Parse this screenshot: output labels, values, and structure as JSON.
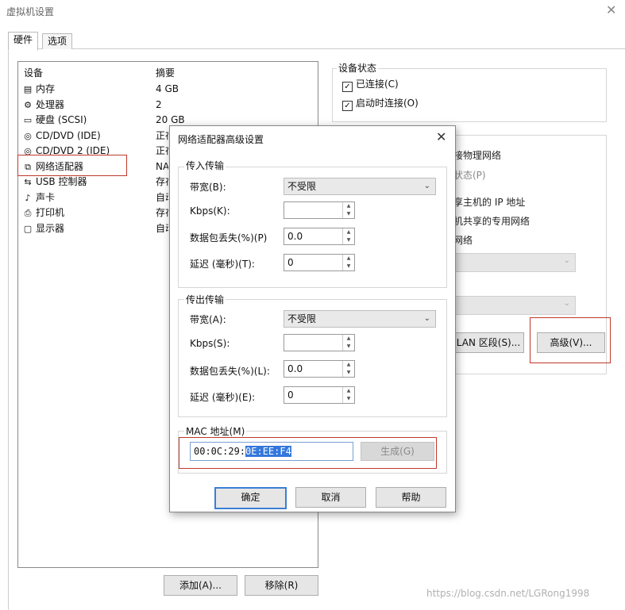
{
  "window": {
    "title": "虚拟机设置",
    "close_glyph": "✕"
  },
  "tabs": [
    {
      "label": "硬件"
    },
    {
      "label": "选项"
    }
  ],
  "device_list": {
    "col_device": "设备",
    "col_summary": "摘要",
    "items": [
      {
        "name": "内存",
        "summary": "4 GB",
        "icon": "memory-icon"
      },
      {
        "name": "处理器",
        "summary": "2",
        "icon": "cpu-icon"
      },
      {
        "name": "硬盘 (SCSI)",
        "summary": "20 GB",
        "icon": "disk-icon"
      },
      {
        "name": "CD/DVD (IDE)",
        "summary": "正在",
        "icon": "cd-icon"
      },
      {
        "name": "CD/DVD 2 (IDE)",
        "summary": "正在",
        "icon": "cd-icon"
      },
      {
        "name": "网络适配器",
        "summary": "NAT",
        "icon": "network-icon"
      },
      {
        "name": "USB 控制器",
        "summary": "存在",
        "icon": "usb-icon"
      },
      {
        "name": "声卡",
        "summary": "自动",
        "icon": "speaker-icon"
      },
      {
        "name": "打印机",
        "summary": "存在",
        "icon": "printer-icon"
      },
      {
        "name": "显示器",
        "summary": "自动",
        "icon": "monitor-icon"
      }
    ],
    "add_button": "添加(A)...",
    "remove_button": "移除(R)"
  },
  "device_status": {
    "label": "设备状态",
    "connected": {
      "label": "已连接(C)",
      "checked": true
    },
    "connect_on_start": {
      "label": "启动时连接(O)",
      "checked": true
    }
  },
  "background_partial": {
    "bridged": "接物理网络",
    "replicate": "状态(P)",
    "nat": "享主机的 IP 地址",
    "host_only": "机共享的专用网络",
    "custom": "网络",
    "lan_segments_button": "LAN 区段(S)...",
    "advanced_button": "高级(V)..."
  },
  "dialog": {
    "title": "网络适配器高级设置",
    "close_glyph": "✕",
    "incoming": {
      "label": "传入传输",
      "bandwidth_label": "带宽(B):",
      "bandwidth_value": "不受限",
      "kbps_label": "Kbps(K):",
      "kbps_value": "",
      "loss_label": "数据包丢失(%)(P)",
      "loss_value": "0.0",
      "latency_label": "延迟 (毫秒)(T):",
      "latency_value": "0"
    },
    "outgoing": {
      "label": "传出传输",
      "bandwidth_label": "带宽(A):",
      "bandwidth_value": "不受限",
      "kbps_label": "Kbps(S):",
      "kbps_value": "",
      "loss_label": "数据包丢失(%)(L):",
      "loss_value": "0.0",
      "latency_label": "延迟 (毫秒)(E):",
      "latency_value": "0"
    },
    "mac": {
      "label": "MAC 地址(M)",
      "prefix": "00:0C:29:",
      "selected": "0E:EE:F4",
      "generate_button": "生成(G)"
    },
    "ok_button": "确定",
    "cancel_button": "取消",
    "help_button": "帮助"
  },
  "watermark": "https://blog.csdn.net/LGRong1998",
  "colors": {
    "highlight_box": "#c0392b",
    "selection": "#3377dd",
    "default_button_border": "#3b7fd4"
  }
}
